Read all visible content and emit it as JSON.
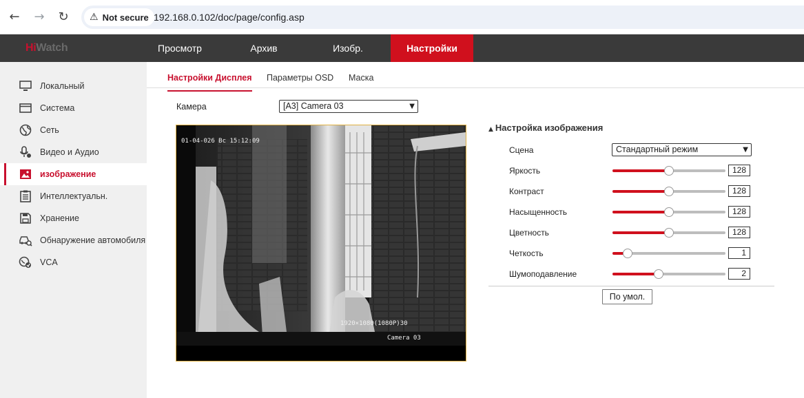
{
  "browser": {
    "security_label": "Not secure",
    "url": "192.168.0.102/doc/page/config.asp"
  },
  "header": {
    "logo_hi": "Hi",
    "logo_watch": "Watch",
    "nav": [
      "Просмотр",
      "Архив",
      "Изобр.",
      "Настройки"
    ],
    "active_nav": "Настройки"
  },
  "sidebar": {
    "items": [
      {
        "label": "Локальный",
        "icon": "monitor-icon"
      },
      {
        "label": "Система",
        "icon": "system-window-icon"
      },
      {
        "label": "Сеть",
        "icon": "globe-icon"
      },
      {
        "label": "Видео и Аудио",
        "icon": "microphone-icon"
      },
      {
        "label": "изображение",
        "icon": "image-icon",
        "active": true
      },
      {
        "label": "Интеллектуальн.",
        "icon": "clipboard-icon"
      },
      {
        "label": "Хранение",
        "icon": "floppy-icon"
      },
      {
        "label": "Обнаружение автомобиля",
        "icon": "vehicle-search-icon"
      },
      {
        "label": "VCA",
        "icon": "vca-icon"
      }
    ]
  },
  "tabs": [
    "Настройки Дисплея",
    "Параметры OSD",
    "Маска"
  ],
  "camera": {
    "label": "Камера",
    "selected": "[A3] Camera 03"
  },
  "video": {
    "osd_datetime": "01-04-026 Вс 15:12:09",
    "osd_resolution": "1920×1080(1080P)30",
    "osd_name": "Camera 03"
  },
  "image_settings": {
    "title": "Настройка изображения",
    "scene_label": "Сцена",
    "scene_value": "Стандартный режим",
    "sliders": [
      {
        "label": "Яркость",
        "value": "128",
        "fraction": 0.5
      },
      {
        "label": "Контраст",
        "value": "128",
        "fraction": 0.5
      },
      {
        "label": "Насыщенность",
        "value": "128",
        "fraction": 0.5
      },
      {
        "label": "Цветность",
        "value": "128",
        "fraction": 0.5
      },
      {
        "label": "Четкость",
        "value": "1",
        "fraction": 0.1
      },
      {
        "label": "Шумоподавление",
        "value": "2",
        "fraction": 0.4
      }
    ],
    "default_button": "По умол."
  },
  "colors": {
    "accent": "#d0101d",
    "header_bg": "#3a3a3a",
    "sidebar_bg": "#f0f0f0"
  }
}
